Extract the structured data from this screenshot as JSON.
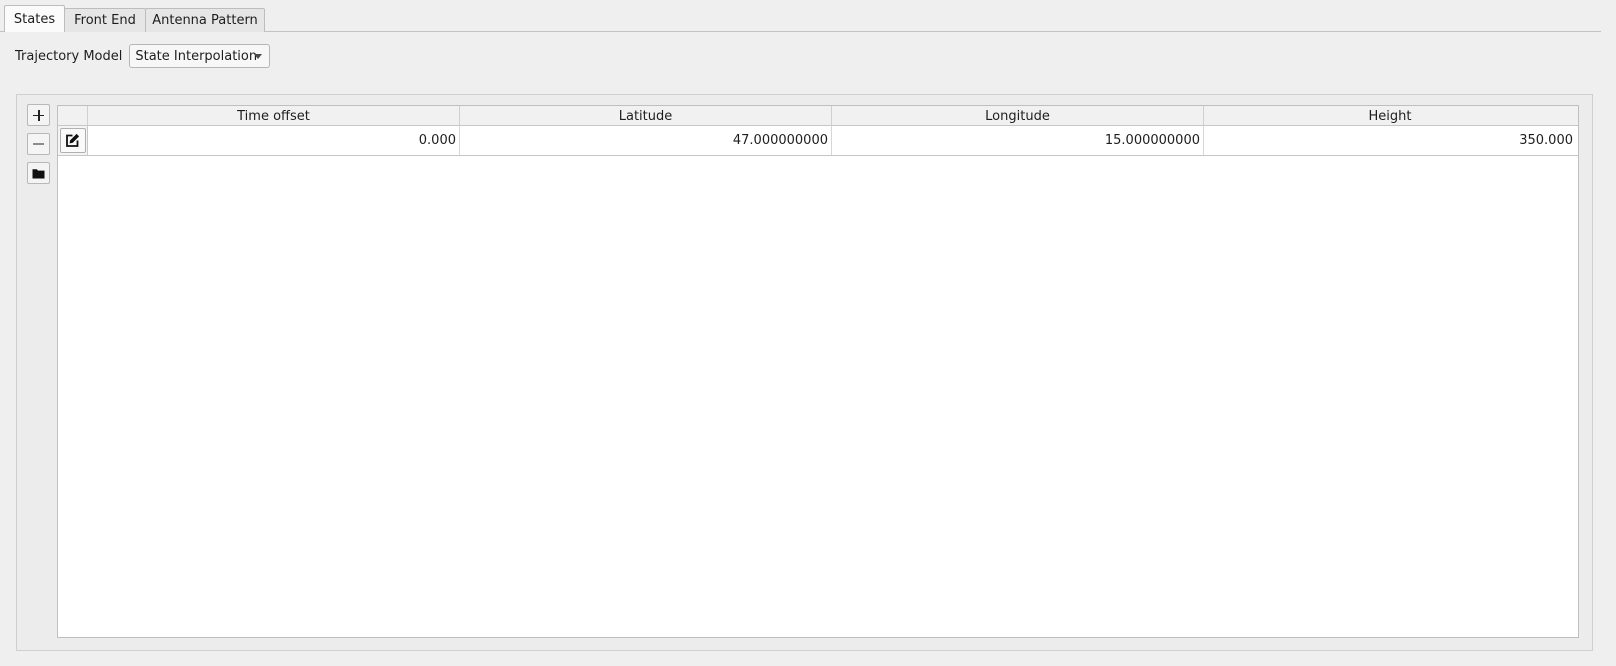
{
  "tabs": [
    {
      "label": "States",
      "active": true
    },
    {
      "label": "Front End",
      "active": false
    },
    {
      "label": "Antenna Pattern",
      "active": false
    }
  ],
  "trajectory": {
    "label": "Trajectory Model",
    "selected": "State Interpolation"
  },
  "toolbar": {
    "add_icon": "plus-icon",
    "remove_icon": "minus-icon",
    "open_icon": "folder-icon"
  },
  "table": {
    "columns": [
      "Time offset",
      "Latitude",
      "Longitude",
      "Height"
    ],
    "rows": [
      {
        "edit_icon": "edit-icon",
        "cells": [
          "0.000",
          "47.000000000",
          "15.000000000",
          "350.000"
        ]
      }
    ]
  }
}
